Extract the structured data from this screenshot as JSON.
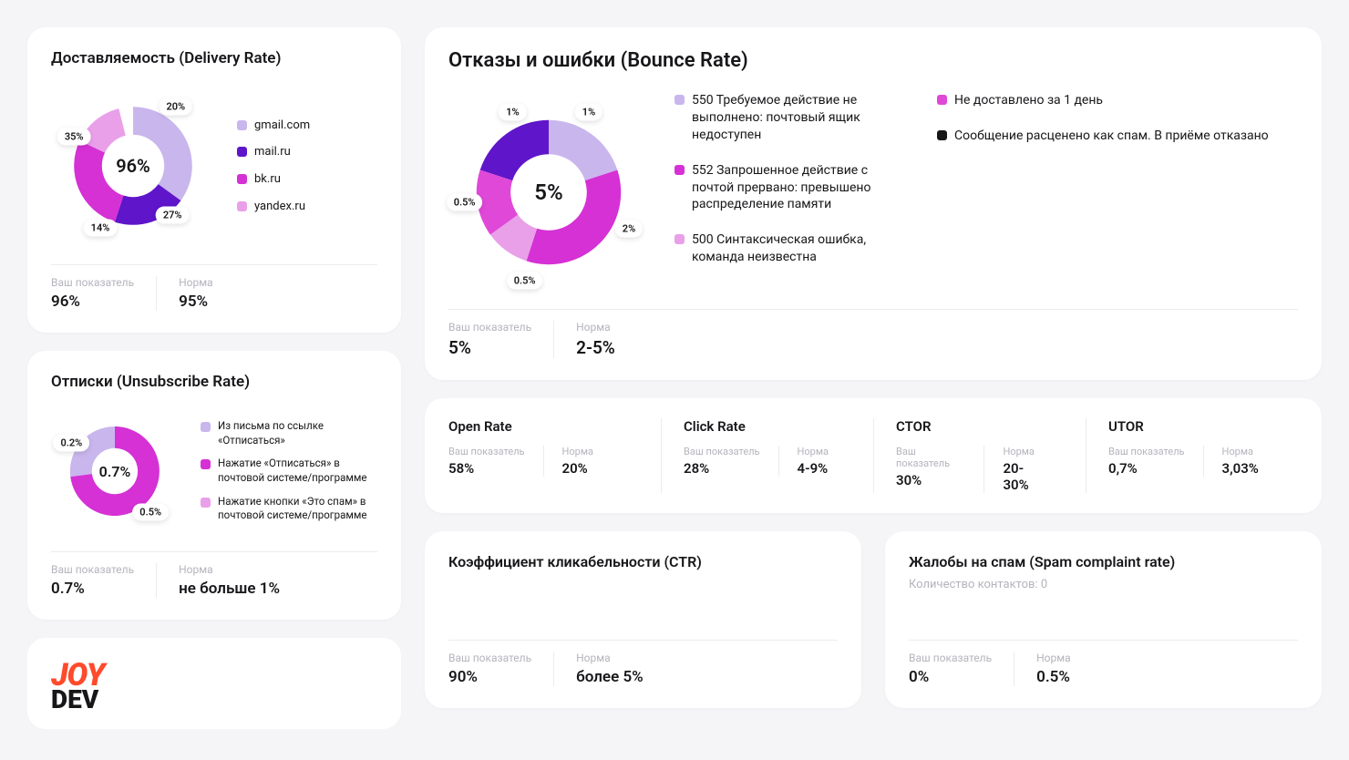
{
  "labels": {
    "your_metric": "Ваш показатель",
    "norm": "Норма"
  },
  "delivery": {
    "title": "Доставляемость (Delivery Rate)",
    "center": "96%",
    "your_value": "96%",
    "norm_value": "95%",
    "legend": [
      {
        "label": "gmail.com",
        "color": "#c9b6ed"
      },
      {
        "label": "mail.ru",
        "color": "#5f15c9"
      },
      {
        "label": "bk.ru",
        "color": "#d531d5"
      },
      {
        "label": "yandex.ru",
        "color": "#e9a0e9"
      }
    ],
    "slice_labels": [
      {
        "text": "20%"
      },
      {
        "text": "27%"
      },
      {
        "text": "14%"
      },
      {
        "text": "35%"
      }
    ]
  },
  "unsubscribe": {
    "title": "Отписки (Unsubscribe Rate)",
    "center": "0.7%",
    "your_value": "0.7%",
    "norm_value": "не больше 1%",
    "legend": [
      {
        "label": "Из письма по ссылке «Отписаться»",
        "color": "#c9b6ed"
      },
      {
        "label": "Нажатие «Отписаться» в почтовой системе/программе",
        "color": "#d531d5"
      },
      {
        "label": "Нажатие кнопки «Это спам» в почтовой системе/программе",
        "color": "#e9a0e9"
      }
    ],
    "slice_labels": [
      {
        "text": "0.2%"
      },
      {
        "text": "0.5%"
      }
    ]
  },
  "bounce": {
    "title": "Отказы и ошибки (Bounce Rate)",
    "center": "5%",
    "your_value": "5%",
    "norm_value": "2-5%",
    "legend_left": [
      {
        "label": "550 Требуемое действие не выполнено: почтовый ящик недоступен",
        "color": "#c9b6ed"
      },
      {
        "label": "552 Запрошенное действие с почтой прервано: превышено распределение памяти",
        "color": "#d531d5"
      },
      {
        "label": "500 Синтаксическая ошибка, команда неизвестна",
        "color": "#e9a0e9"
      }
    ],
    "legend_right": [
      {
        "label": "Не доставлено за 1 день",
        "color": "#e048d8"
      },
      {
        "label": "Сообщение расценено как спам. В приёме отказано",
        "color": "#17171a"
      }
    ],
    "slice_labels": [
      {
        "text": "1%"
      },
      {
        "text": "1%"
      },
      {
        "text": "2%"
      },
      {
        "text": "0.5%"
      },
      {
        "text": "0.5%"
      }
    ]
  },
  "rates": [
    {
      "title": "Open Rate",
      "your": "58%",
      "norm": "20%"
    },
    {
      "title": "Click Rate",
      "your": "28%",
      "norm": "4-9%"
    },
    {
      "title": "CTOR",
      "your": "30%",
      "norm": "20-30%"
    },
    {
      "title": "UTOR",
      "your": "0,7%",
      "norm": "3,03%"
    }
  ],
  "ctr": {
    "title": "Коэффициент кликабельности (CTR)",
    "your_value": "90%",
    "norm_value": "более 5%"
  },
  "spam": {
    "title": "Жалобы на спам (Spam complaint rate)",
    "subtitle": "Количество контактов: 0",
    "your_value": "0%",
    "norm_value": "0.5%"
  },
  "logo": {
    "top": "JOY",
    "bottom": "DEV"
  },
  "chart_data": [
    {
      "type": "pie",
      "title": "Доставляемость (Delivery Rate)",
      "center_value": "96%",
      "series": [
        {
          "name": "gmail.com",
          "value": 35,
          "color": "#c9b6ed"
        },
        {
          "name": "mail.ru",
          "value": 20,
          "color": "#5f15c9"
        },
        {
          "name": "bk.ru",
          "value": 27,
          "color": "#d531d5"
        },
        {
          "name": "yandex.ru",
          "value": 14,
          "color": "#e9a0e9"
        }
      ]
    },
    {
      "type": "pie",
      "title": "Отписки (Unsubscribe Rate)",
      "center_value": "0.7%",
      "series": [
        {
          "name": "Из письма по ссылке «Отписаться»",
          "value": 0.2,
          "color": "#c9b6ed"
        },
        {
          "name": "Нажатие «Отписаться» в почтовой системе/программе",
          "value": 0.5,
          "color": "#d531d5"
        },
        {
          "name": "Нажатие кнопки «Это спам» в почтовой системе/программе",
          "value": 0.0,
          "color": "#e9a0e9"
        }
      ]
    },
    {
      "type": "pie",
      "title": "Отказы и ошибки (Bounce Rate)",
      "center_value": "5%",
      "series": [
        {
          "name": "550 Требуемое действие не выполнено: почтовый ящик недоступен",
          "value": 1,
          "color": "#c9b6ed"
        },
        {
          "name": "552 Запрошенное действие с почтой прервано: превышено распределение памяти",
          "value": 2,
          "color": "#d531d5"
        },
        {
          "name": "500 Синтаксическая ошибка, команда неизвестна",
          "value": 0.5,
          "color": "#e9a0e9"
        },
        {
          "name": "Не доставлено за 1 день",
          "value": 0.5,
          "color": "#e048d8"
        },
        {
          "name": "Сообщение расценено как спам. В приёме отказано",
          "value": 1,
          "color": "#5f15c9"
        }
      ]
    }
  ]
}
